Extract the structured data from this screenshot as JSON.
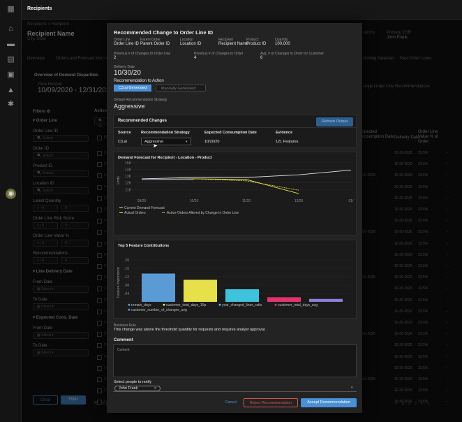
{
  "app": {
    "rail_icons": [
      "grid-icon",
      "home-icon",
      "truck-icon",
      "chart-icon",
      "box-icon",
      "bell-icon",
      "settings-icon",
      "ai-icon"
    ],
    "tab": "Recipients"
  },
  "bg": {
    "breadcrumb": "Recipients  >  Recipient",
    "recipient_name": "Recipient Name",
    "city_state": "City, State",
    "tabs": [
      "Overview",
      "Orders and Forecast Matching"
    ],
    "tab_right": [
      "ations",
      "Primary CSR",
      "John Frank"
    ],
    "tab_right2": [
      "porting Materials",
      "Past Order Lines"
    ],
    "section": "Overview of Demand Disparities",
    "horizon_label": "Time Horizon",
    "horizon": "10/09/2020 - 12/31/2020",
    "range_right": "ange Order Line Recommendations",
    "filters": "Filters",
    "active": "Active",
    "filter_items": [
      {
        "label": "Order Line",
        "type": "head"
      },
      {
        "label": "Order Line ID",
        "type": "search"
      },
      {
        "label": "Order ID",
        "type": "search"
      },
      {
        "label": "Product ID",
        "type": "search"
      },
      {
        "label": "Location ID",
        "type": "search"
      },
      {
        "label": "Latest Quantity",
        "type": "range"
      },
      {
        "label": "Order Line Risk Score",
        "type": "range"
      },
      {
        "label": "Order Line Value %",
        "type": "range"
      },
      {
        "label": "Recommendations",
        "type": "range"
      },
      {
        "label": "Line Delivery Date",
        "type": "head"
      },
      {
        "label": "From Date",
        "type": "date"
      },
      {
        "label": "To Date",
        "type": "date"
      },
      {
        "label": "Expected Cons. Date",
        "type": "head"
      },
      {
        "label": "From Date",
        "type": "date"
      },
      {
        "label": "To Date",
        "type": "date"
      }
    ],
    "search_ph": "Search",
    "select_ph": "Select",
    "range_ph": "0",
    "clear": "Clear",
    "filter": "Filter",
    "search_tbl": "Se",
    "col_or": "Or",
    "rows_label": "Rows p",
    "col_headers": {
      "expected": "xpected\nonsumption Date",
      "delivery": "Delivery Date",
      "value": "Order Line Value % of Order"
    },
    "row_dates": [
      "",
      "",
      "10-30-2020",
      "",
      "",
      "",
      "",
      "10-30-2020",
      "",
      "",
      "",
      "10-30-2020",
      "",
      "",
      "",
      "",
      "10-30-2020",
      "",
      "",
      "",
      "10-30-2020",
      "",
      ""
    ],
    "row_delivery": "10-30-2020",
    "row_value": "23.5%",
    "row_more": "···",
    "pager": [
      "<",
      "1",
      "2",
      "3",
      ">",
      "»"
    ]
  },
  "modal": {
    "title": "Recommended Change to Order Line ID",
    "fields": [
      {
        "label": "Order Line",
        "value": "Order Line ID"
      },
      {
        "label": "Parent Order",
        "value": "Parent Order ID"
      },
      {
        "label": "Location",
        "value": "Location ID"
      },
      {
        "label": "Recipient",
        "value": "Recipient Name"
      },
      {
        "label": "Product",
        "value": "Product ID"
      },
      {
        "label": "Quantity",
        "value": "100,000"
      }
    ],
    "prev": [
      {
        "label": "Previous # of Changes to Order Line",
        "value": "2"
      },
      {
        "label": "Previous # of Changes to Order",
        "value": "4"
      },
      {
        "label": "Avg. # of Changes to Order for Customer",
        "value": "6"
      }
    ],
    "delivery_label": "Delivery Date",
    "delivery": "10/30/20",
    "rec_action_label": "Recommendation to Action",
    "seg_active": "C3.ai Generated",
    "seg_inactive": "Manually Generated",
    "strategy_label": "Default Recommendation Strategy",
    "strategy": "Aggressive",
    "rec_changes": "Recommended Changes",
    "refresh": "Refresh Output",
    "rc_headers": [
      "Source",
      "Recommendation Strategy",
      "Expected Consumption Date",
      "Evidence"
    ],
    "rc_row": {
      "source": "C3.ai",
      "strategy": "Aggressive",
      "date": "10/20/20",
      "evidence": "121 Features"
    },
    "forecast_title": "Demand Forecast for Recipient - Location - Product",
    "forecast_legend": [
      "Current Demand Forecast",
      "Actual Orders",
      "Active Orders Altered by Change in Order Line"
    ],
    "fi_title": "Top 5 Feature Contributions",
    "fi_ylabel": "Feature Importance",
    "business_rule_label": "Business Rule",
    "business_rule": "This change was above the threshold quantity for requests and requires analyst approval.",
    "comment_label": "Comment",
    "comment_ph": "Content",
    "notify_label": "Select people to notify",
    "notify_chip": "John Frank",
    "cancel": "Cancel",
    "reject": "Reject Recommendation",
    "accept": "Accept Recommendation"
  },
  "colors": {
    "accent": "#4a90d6",
    "yellow": "#e6e04a",
    "pink": "#e0336f",
    "cyan": "#3fc3dd",
    "purple": "#8a7fd6",
    "white": "#e6e6e6",
    "reject": "#d9534f"
  },
  "chart_data": [
    {
      "type": "line",
      "title": "Demand Forecast for Recipient - Location - Product",
      "ylabel": "Units",
      "yticks": [
        "11K",
        "12K",
        "13K",
        "14K",
        "15K"
      ],
      "x_ticks": [
        "09/20",
        "10/20",
        "11/20",
        "12/20",
        "01/"
      ],
      "series": [
        {
          "name": "Current Demand Forecast",
          "color": "#e6e6e6",
          "x": [
            "09/20",
            "10/20",
            "11/20",
            "12/20",
            "01/"
          ],
          "y": [
            12.6,
            12.8,
            12.8,
            13.2,
            13.9
          ]
        },
        {
          "name": "Actual Orders",
          "color": "#e6e04a",
          "x": [
            "09/20",
            "10/20",
            "11/20",
            "12/20"
          ],
          "y": [
            12.5,
            12.6,
            12.5,
            10.4
          ]
        },
        {
          "name": "Active Orders Altered by Change in Order Line",
          "color": "#e6e04a",
          "dashed": true,
          "x": [
            "10/20",
            "11/20",
            "12/20"
          ],
          "y": [
            12.6,
            12.3,
            10.9
          ]
        },
        {
          "name": "",
          "color": "#8a7fd6",
          "x": [
            "09/20",
            "10/20"
          ],
          "y": [
            12.5,
            12.5
          ]
        }
      ],
      "ylim": [
        10.3,
        15.3
      ]
    },
    {
      "type": "bar",
      "title": "Top 5 Feature Contributions",
      "ylabel": "Feature Importance",
      "yticks": [
        ".04",
        ".08",
        ".12",
        ".16",
        ".20"
      ],
      "ylim": [
        0,
        0.22
      ],
      "categories": [
        "remain_days",
        "customer_total_days_15p",
        "year_changed_lines_ratio",
        "customer_total_days_avg",
        "customer_number_of_changes_avg"
      ],
      "values": [
        0.135,
        0.105,
        0.06,
        0.022,
        0.014
      ],
      "colors": [
        "#5a9bd5",
        "#e6e04a",
        "#3fc3dd",
        "#e0336f",
        "#8a7fd6"
      ]
    }
  ]
}
